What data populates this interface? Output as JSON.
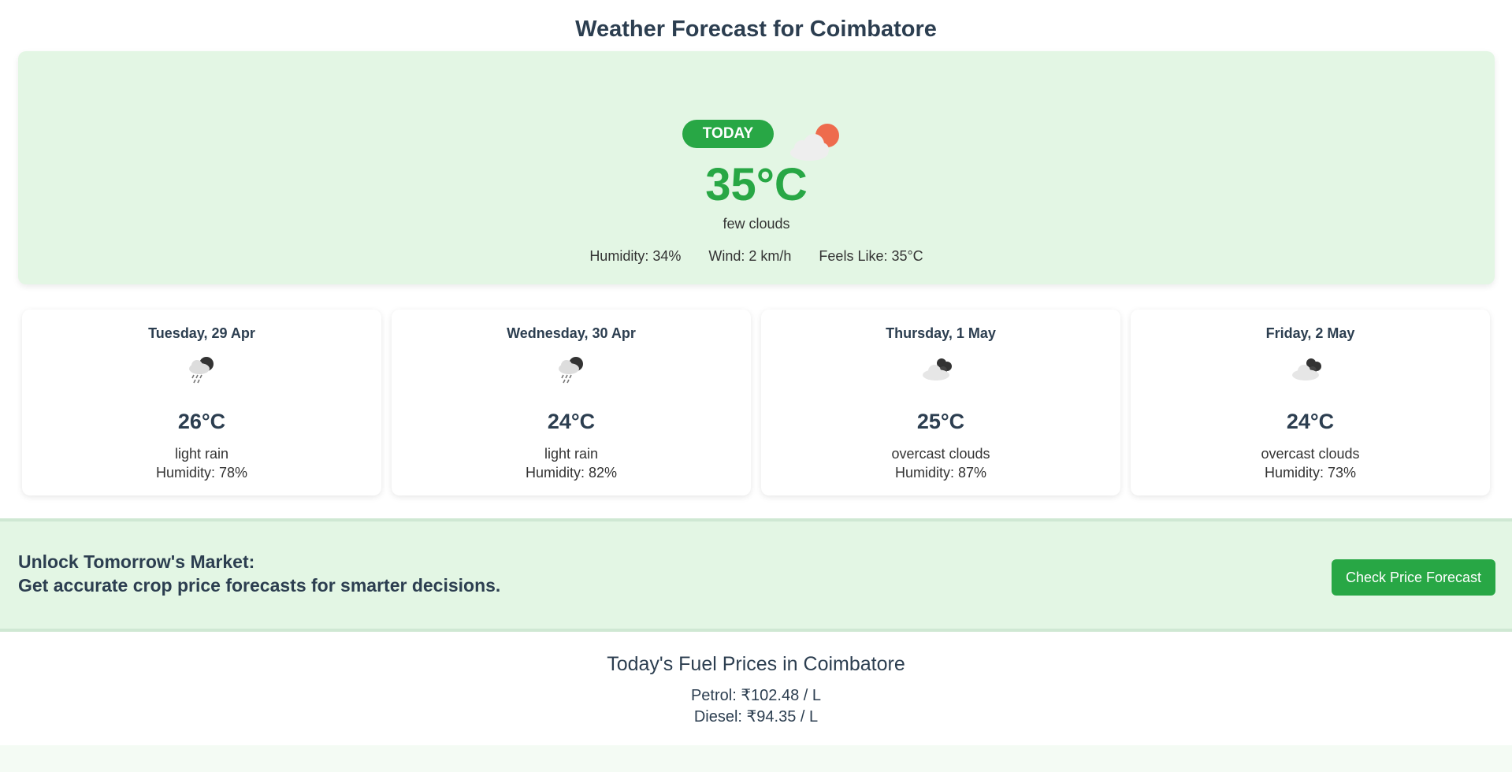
{
  "page": {
    "title": "Weather Forecast for Coimbatore"
  },
  "today": {
    "badge": "TODAY",
    "icon": "few-clouds-icon",
    "temperature": "35°C",
    "description": "few clouds",
    "humidity": "Humidity: 34%",
    "wind": "Wind: 2 km/h",
    "feels_like": "Feels Like: 35°C"
  },
  "forecast": [
    {
      "date": "Tuesday, 29 Apr",
      "icon": "light-rain-icon",
      "temperature": "26°C",
      "description": "light rain",
      "humidity": "Humidity: 78%"
    },
    {
      "date": "Wednesday, 30 Apr",
      "icon": "light-rain-icon",
      "temperature": "24°C",
      "description": "light rain",
      "humidity": "Humidity: 82%"
    },
    {
      "date": "Thursday, 1 May",
      "icon": "overcast-clouds-icon",
      "temperature": "25°C",
      "description": "overcast clouds",
      "humidity": "Humidity: 87%"
    },
    {
      "date": "Friday, 2 May",
      "icon": "overcast-clouds-icon",
      "temperature": "24°C",
      "description": "overcast clouds",
      "humidity": "Humidity: 73%"
    }
  ],
  "promo": {
    "line1": "Unlock Tomorrow's Market:",
    "line2": "Get accurate crop price forecasts for smarter decisions.",
    "button_label": "Check Price Forecast"
  },
  "fuel": {
    "title": "Today's Fuel Prices in Coimbatore",
    "petrol": "Petrol: ₹102.48 / L",
    "diesel": "Diesel: ₹94.35 / L"
  },
  "colors": {
    "accent": "#28a745",
    "card_background": "#e3f6e4",
    "text": "#2c3e50",
    "sun": "#ee6b4d"
  }
}
